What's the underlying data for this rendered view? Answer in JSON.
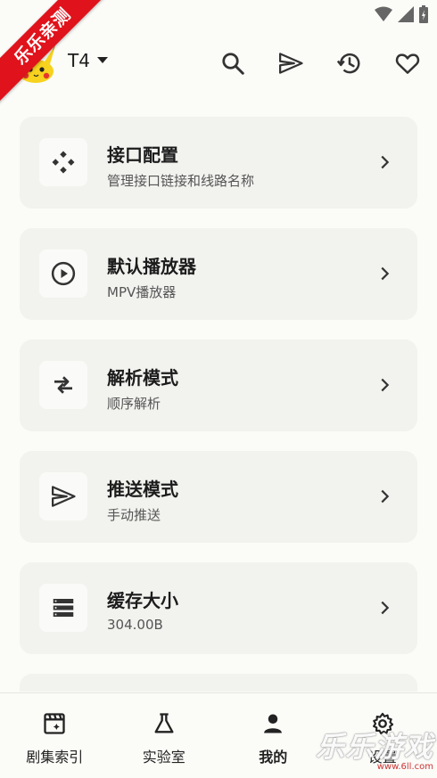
{
  "watermark": {
    "ribbon": "乐乐亲测",
    "corner_text": "乐乐游戏",
    "corner_url": "www.6ll.com"
  },
  "header": {
    "source_name": "T4",
    "icons": [
      "search-icon",
      "send-icon",
      "history-icon",
      "favorite-icon"
    ]
  },
  "settings": [
    {
      "title": "接口配置",
      "subtitle": "管理接口链接和线路名称",
      "icon": "interface-icon"
    },
    {
      "title": "默认播放器",
      "subtitle": "MPV播放器",
      "icon": "play-icon"
    },
    {
      "title": "解析模式",
      "subtitle": "顺序解析",
      "icon": "swap-icon"
    },
    {
      "title": "推送模式",
      "subtitle": "手动推送",
      "icon": "send-icon"
    },
    {
      "title": "缓存大小",
      "subtitle": "304.00B",
      "icon": "storage-icon"
    }
  ],
  "bottom_nav": [
    {
      "label": "剧集索引",
      "icon": "clapperboard-icon",
      "active": false
    },
    {
      "label": "实验室",
      "icon": "flask-icon",
      "active": false
    },
    {
      "label": "我的",
      "icon": "person-icon",
      "active": true
    },
    {
      "label": "设置",
      "icon": "gear-icon",
      "active": false
    }
  ],
  "colors": {
    "background": "#fbfbf8",
    "card": "#f2f2ef",
    "ribbon": "#e0121b",
    "text": "#1c1c1c"
  }
}
